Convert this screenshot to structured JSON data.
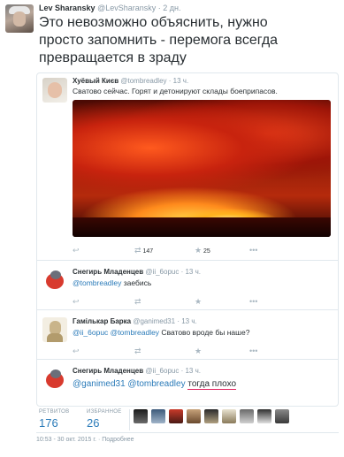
{
  "main": {
    "author_name": "Lev Sharansky",
    "author_handle": "@LevSharansky",
    "separator": "·",
    "time": "2 дн.",
    "text": "Это невозможно объяснить, нужно\nпросто запомнить - перемога всегда\nпревращается в зраду"
  },
  "thread": [
    {
      "name": "Хуёвый Києв",
      "handle": "@tombreadley",
      "time": "· 13 ч.",
      "text": "Сватово сейчас. Горят и детонируют склады боеприпасов.",
      "retweets": "147",
      "favorites": "25"
    },
    {
      "name": "Снегирь Младенцев",
      "handle": "@ii_6opuc",
      "time": "· 13 ч.",
      "mention": "@tombreadley",
      "text": " заебись"
    },
    {
      "name": "Гамількар Барка",
      "handle": "@ganimed31",
      "time": "· 13 ч.",
      "mention": "@ii_6opuc @tombreadley",
      "text": " Сватово вроде бы наше?"
    },
    {
      "name": "Снегирь Младенцев",
      "handle": "@ii_6opuc",
      "time": "· 13 ч.",
      "mention": "@ganimed31 @tombreadley",
      "text": "тогда плохо"
    }
  ],
  "stats": {
    "retweets_label": "РЕТВИТОВ",
    "retweets": "176",
    "favorites_label": "ИЗБРАННОЕ",
    "favorites": "26"
  },
  "footer": {
    "timestamp": "10:53 - 30 окт. 2015 г.",
    "separator": "·",
    "details_link": "Подробнее"
  },
  "colors": {
    "link": "#2b7bb9",
    "muted": "#8899a6",
    "border": "#e1e8ed",
    "underline": "#e0245e"
  }
}
